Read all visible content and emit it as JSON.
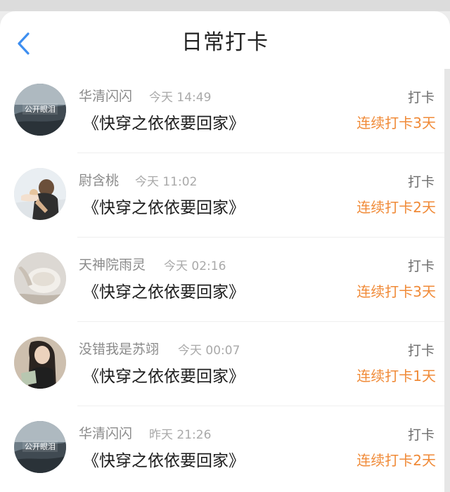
{
  "header": {
    "title": "日常打卡",
    "back_icon": "chevron-left-icon",
    "accent_color": "#3d8ef0"
  },
  "entries": [
    {
      "name": "华清闪闪",
      "time": "今天 14:49",
      "book": "《快穿之依依要回家》",
      "action": "打卡",
      "streak": "连续打卡3天",
      "avatar_text": "公开眼泪"
    },
    {
      "name": "尉含桃",
      "time": "今天 11:02",
      "book": "《快穿之依依要回家》",
      "action": "打卡",
      "streak": "连续打卡2天"
    },
    {
      "name": "天神院雨灵",
      "time": "今天 02:16",
      "book": "《快穿之依依要回家》",
      "action": "打卡",
      "streak": "连续打卡3天"
    },
    {
      "name": "没错我是苏翊",
      "time": "今天 00:07",
      "book": "《快穿之依依要回家》",
      "action": "打卡",
      "streak": "连续打卡1天"
    },
    {
      "name": "华清闪闪",
      "time": "昨天 21:26",
      "book": "《快穿之依依要回家》",
      "action": "打卡",
      "streak": "连续打卡2天",
      "avatar_text": "公开眼泪"
    }
  ],
  "colors": {
    "streak": "#f08a37",
    "name": "#8a8a8a",
    "time": "#a9a9a9"
  }
}
